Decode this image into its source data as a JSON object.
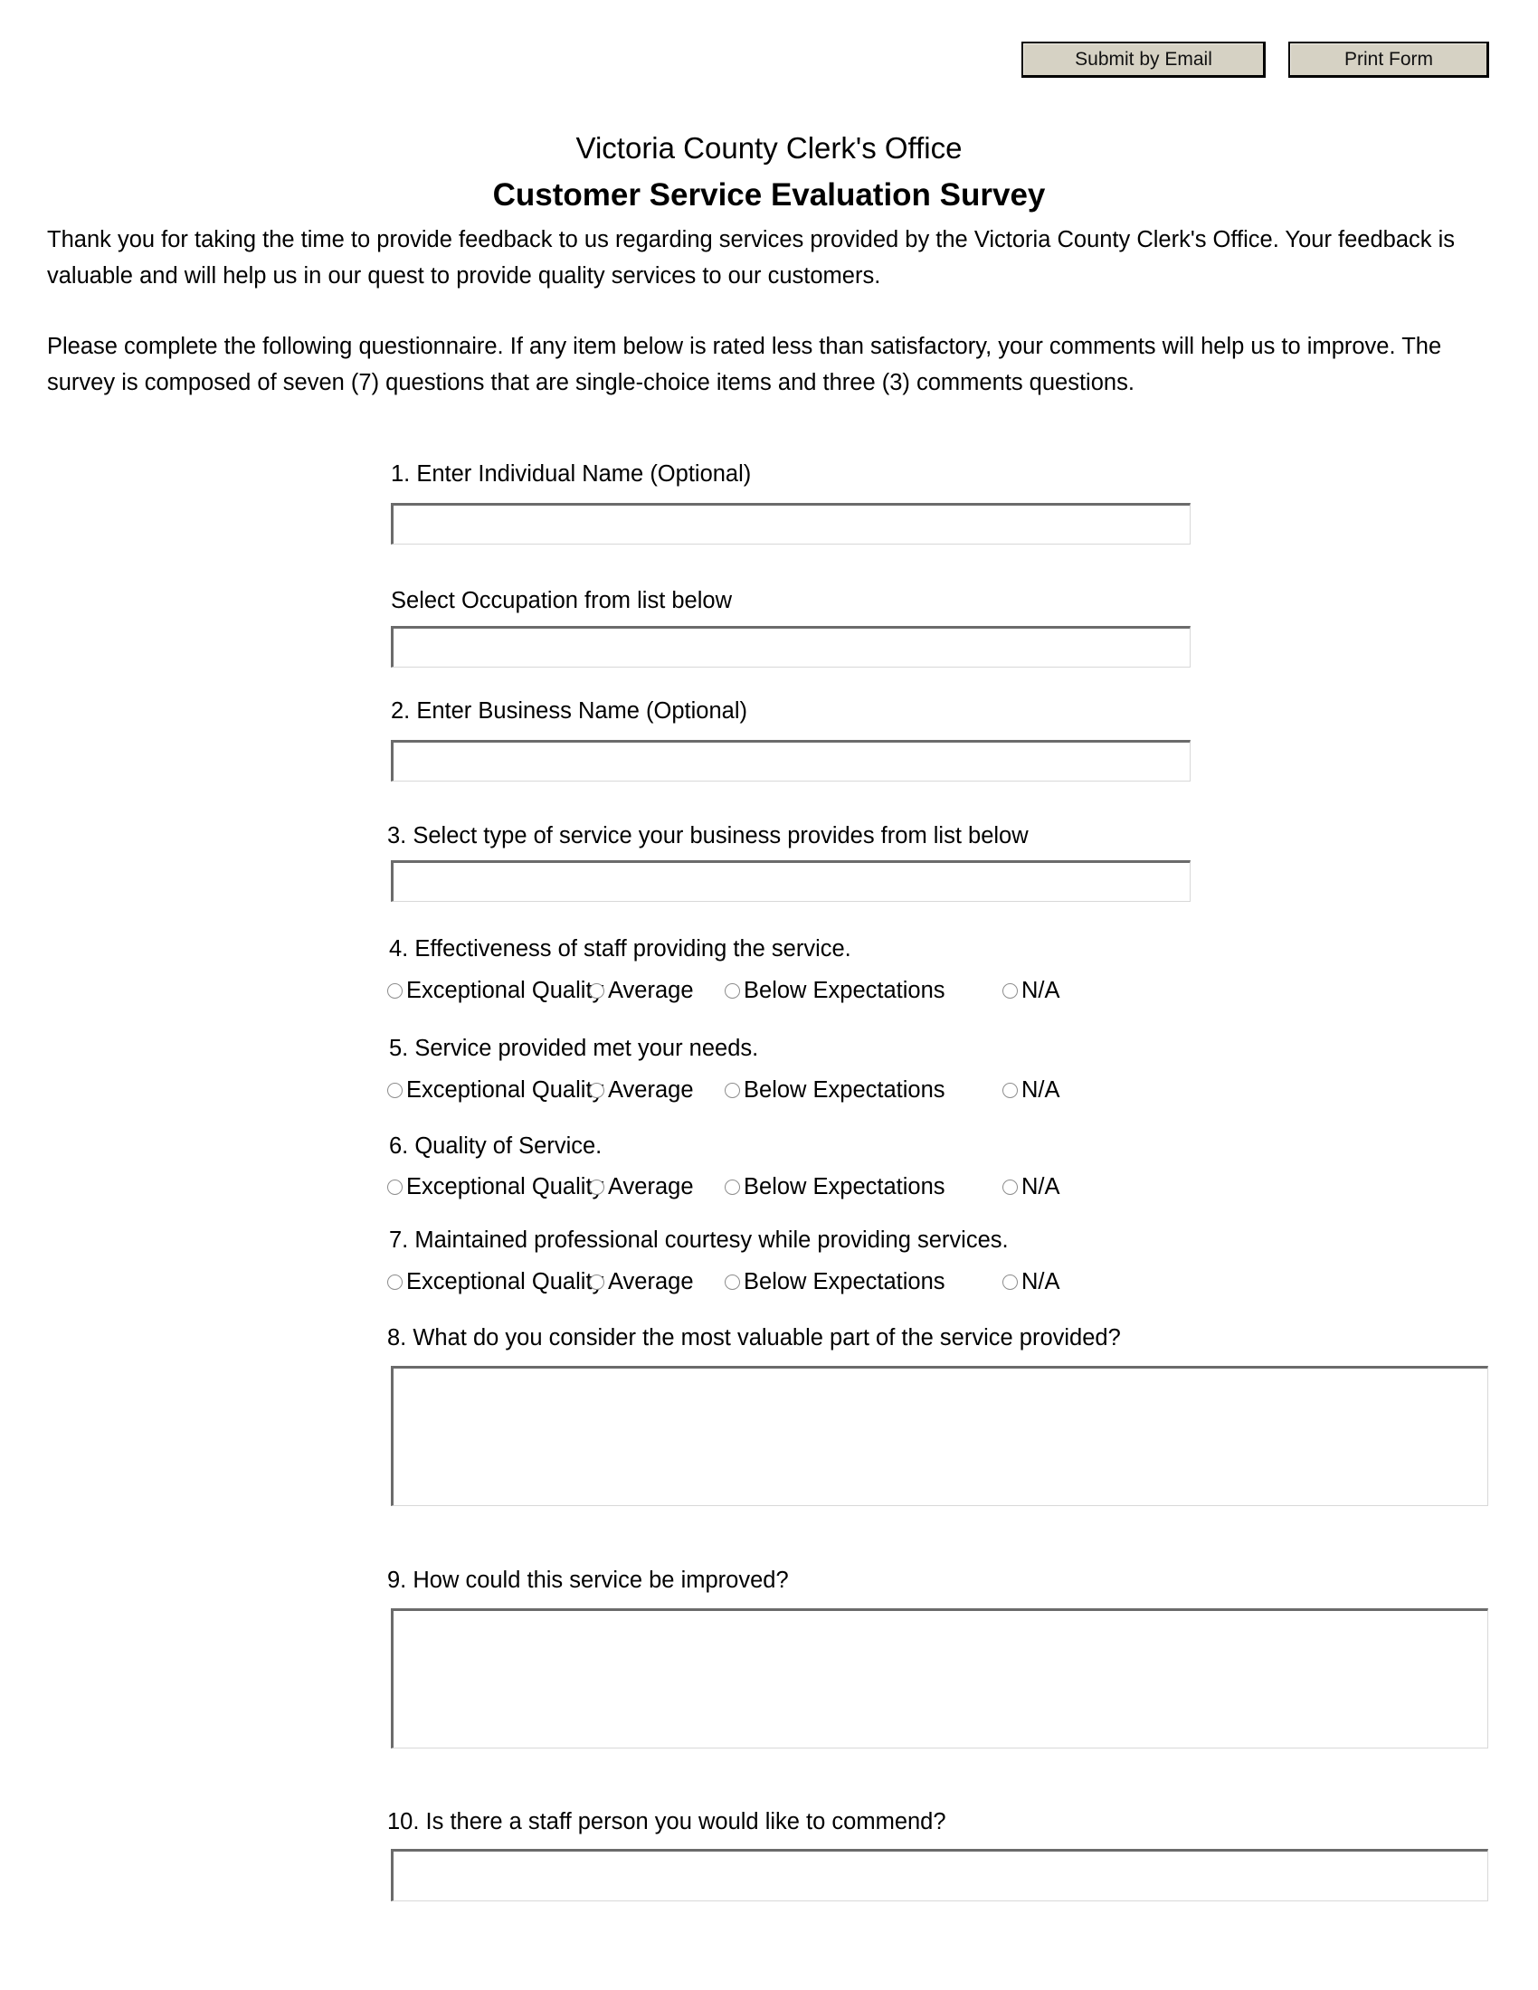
{
  "toolbar": {
    "submit_label": "Submit by Email",
    "print_label": "Print Form"
  },
  "header": {
    "organization": "Victoria County Clerk's Office",
    "title": "Customer Service Evaluation Survey"
  },
  "intro": {
    "paragraph1": "Thank you for taking the time to provide feedback to us regarding services provided by the Victoria County Clerk's Office.  Your feedback is valuable and will help us in our quest to provide quality services to our customers.",
    "paragraph2": "Please complete the following questionnaire.  If any item below is rated less than satisfactory, your comments will help us to improve.  The survey is composed of seven (7) questions that are single-choice items and three (3) comments questions."
  },
  "rating_options": [
    {
      "label": "Exceptional Quality"
    },
    {
      "label": "Average"
    },
    {
      "label": "Below Expectations"
    },
    {
      "label": "N/A"
    }
  ],
  "questions": [
    {
      "id": "q1",
      "label": "1.  Enter Individual Name (Optional)",
      "type": "text",
      "value": "",
      "placeholder": ""
    },
    {
      "id": "occupation",
      "label": "Select Occupation from list below",
      "type": "select",
      "value": "",
      "placeholder": ""
    },
    {
      "id": "q2",
      "label": "2.  Enter Business Name (Optional)",
      "type": "text",
      "value": "",
      "placeholder": ""
    },
    {
      "id": "q3",
      "label": "3.  Select type of service your business provides from list below",
      "type": "select",
      "value": "",
      "placeholder": ""
    },
    {
      "id": "q4",
      "label": "4.  Effectiveness of staff providing the service.",
      "type": "radio",
      "selected": null
    },
    {
      "id": "q5",
      "label": "5.  Service provided met your needs.",
      "type": "radio",
      "selected": null
    },
    {
      "id": "q6",
      "label": "6.  Quality of Service.",
      "type": "radio",
      "selected": null
    },
    {
      "id": "q7",
      "label": "7.  Maintained professional courtesy while providing services.",
      "type": "radio",
      "selected": null
    },
    {
      "id": "q8",
      "label": "8.  What do you consider the most valuable part of the service provided?",
      "type": "textarea",
      "value": "",
      "placeholder": ""
    },
    {
      "id": "q9",
      "label": "9.  How could this service be improved?",
      "type": "textarea",
      "value": "",
      "placeholder": ""
    },
    {
      "id": "q10",
      "label": "10.  Is there a staff person you would like to commend?",
      "type": "text",
      "value": "",
      "placeholder": ""
    }
  ]
}
